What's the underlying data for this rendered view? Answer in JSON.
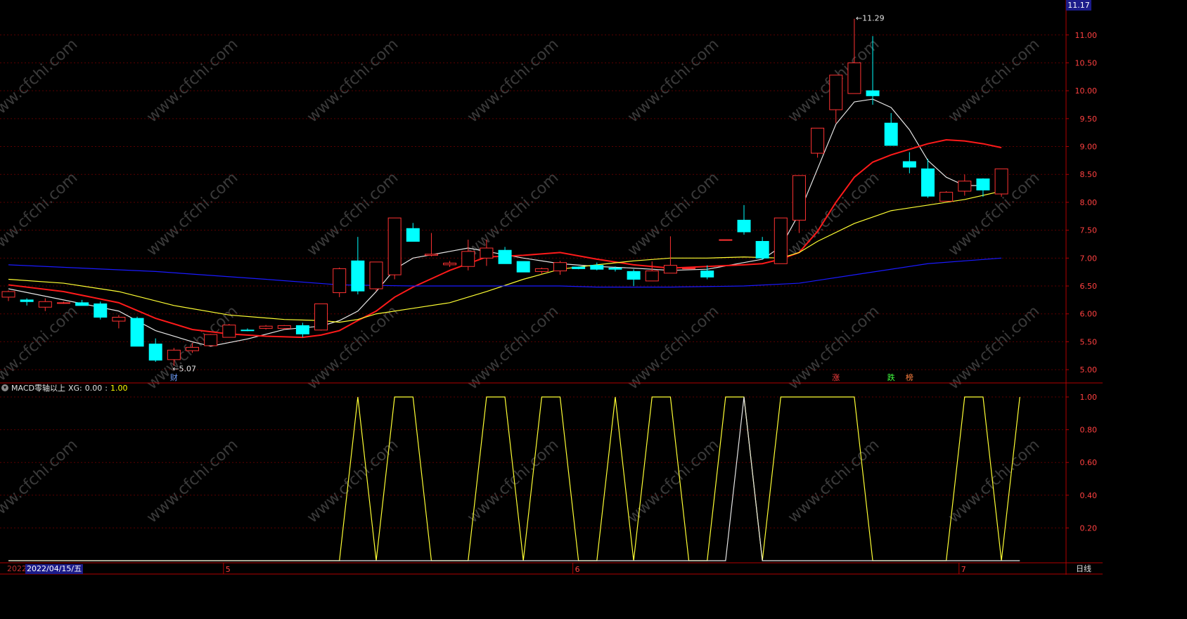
{
  "chart_data": [
    {
      "type": "candlestick",
      "title": "",
      "y_ticks": [
        "11.00",
        "10.50",
        "10.00",
        "9.50",
        "9.00",
        "8.50",
        "8.00",
        "7.50",
        "7.00",
        "6.50",
        "6.00",
        "5.50",
        "5.00"
      ],
      "ylim": [
        4.8,
        11.4
      ],
      "current_price": "11.17",
      "annotations": {
        "high_label": "11.29",
        "low_label": "5.07",
        "event_markers": [
          "财",
          "涨",
          "跌",
          "榜"
        ]
      },
      "candles": [
        {
          "o": 6.3,
          "h": 6.42,
          "l": 6.23,
          "c": 6.4
        },
        {
          "o": 6.25,
          "h": 6.28,
          "l": 6.15,
          "c": 6.22
        },
        {
          "o": 6.12,
          "h": 6.28,
          "l": 6.05,
          "c": 6.22
        },
        {
          "o": 6.19,
          "h": 6.22,
          "l": 6.18,
          "c": 6.2
        },
        {
          "o": 6.2,
          "h": 6.25,
          "l": 6.15,
          "c": 6.15
        },
        {
          "o": 6.18,
          "h": 6.22,
          "l": 5.9,
          "c": 5.94
        },
        {
          "o": 5.87,
          "h": 5.98,
          "l": 5.74,
          "c": 5.94
        },
        {
          "o": 5.92,
          "h": 5.95,
          "l": 5.44,
          "c": 5.42
        },
        {
          "o": 5.46,
          "h": 5.56,
          "l": 5.14,
          "c": 5.17
        },
        {
          "o": 5.18,
          "h": 5.39,
          "l": 5.07,
          "c": 5.35
        },
        {
          "o": 5.34,
          "h": 5.48,
          "l": 5.3,
          "c": 5.4
        },
        {
          "o": 5.43,
          "h": 5.64,
          "l": 5.43,
          "c": 5.63
        },
        {
          "o": 5.58,
          "h": 5.82,
          "l": 5.58,
          "c": 5.8
        },
        {
          "o": 5.71,
          "h": 5.74,
          "l": 5.69,
          "c": 5.7
        },
        {
          "o": 5.74,
          "h": 5.8,
          "l": 5.72,
          "c": 5.78
        },
        {
          "o": 5.74,
          "h": 5.8,
          "l": 5.72,
          "c": 5.79
        },
        {
          "o": 5.79,
          "h": 5.84,
          "l": 5.58,
          "c": 5.64
        },
        {
          "o": 5.71,
          "h": 6.18,
          "l": 5.7,
          "c": 6.18
        },
        {
          "o": 6.38,
          "h": 6.83,
          "l": 6.3,
          "c": 6.81
        },
        {
          "o": 6.95,
          "h": 7.38,
          "l": 6.35,
          "c": 6.41
        },
        {
          "o": 6.45,
          "h": 6.93,
          "l": 6.41,
          "c": 6.93
        },
        {
          "o": 6.7,
          "h": 7.72,
          "l": 6.62,
          "c": 7.72
        },
        {
          "o": 7.53,
          "h": 7.63,
          "l": 7.3,
          "c": 7.3
        },
        {
          "o": 7.05,
          "h": 7.45,
          "l": 7.03,
          "c": 7.07
        },
        {
          "o": 6.88,
          "h": 6.95,
          "l": 6.84,
          "c": 6.91
        },
        {
          "o": 6.85,
          "h": 7.33,
          "l": 6.78,
          "c": 7.12
        },
        {
          "o": 7.0,
          "h": 7.33,
          "l": 6.86,
          "c": 7.18
        },
        {
          "o": 7.14,
          "h": 7.2,
          "l": 6.9,
          "c": 6.9
        },
        {
          "o": 6.94,
          "h": 6.94,
          "l": 6.75,
          "c": 6.75
        },
        {
          "o": 6.76,
          "h": 6.83,
          "l": 6.71,
          "c": 6.81
        },
        {
          "o": 6.77,
          "h": 6.95,
          "l": 6.7,
          "c": 6.92
        },
        {
          "o": 6.84,
          "h": 6.85,
          "l": 6.8,
          "c": 6.81
        },
        {
          "o": 6.87,
          "h": 6.92,
          "l": 6.78,
          "c": 6.8
        },
        {
          "o": 6.82,
          "h": 6.85,
          "l": 6.76,
          "c": 6.8
        },
        {
          "o": 6.76,
          "h": 6.8,
          "l": 6.5,
          "c": 6.62
        },
        {
          "o": 6.59,
          "h": 6.94,
          "l": 6.59,
          "c": 6.77
        },
        {
          "o": 6.73,
          "h": 7.39,
          "l": 6.73,
          "c": 6.87
        },
        {
          "o": 6.82,
          "h": 6.82,
          "l": 6.82,
          "c": 6.82
        },
        {
          "o": 6.77,
          "h": 6.87,
          "l": 6.62,
          "c": 6.66
        },
        {
          "o": 7.33,
          "h": 7.33,
          "l": 7.33,
          "c": 7.33
        },
        {
          "o": 7.68,
          "h": 7.95,
          "l": 7.42,
          "c": 7.47
        },
        {
          "o": 7.3,
          "h": 7.38,
          "l": 6.97,
          "c": 7.0
        },
        {
          "o": 6.9,
          "h": 7.72,
          "l": 6.9,
          "c": 7.72
        },
        {
          "o": 7.68,
          "h": 8.48,
          "l": 7.45,
          "c": 8.48
        },
        {
          "o": 8.88,
          "h": 9.33,
          "l": 8.8,
          "c": 9.33
        },
        {
          "o": 9.66,
          "h": 10.28,
          "l": 9.42,
          "c": 10.28
        },
        {
          "o": 9.95,
          "h": 11.29,
          "l": 9.95,
          "c": 10.5
        },
        {
          "o": 10.0,
          "h": 10.98,
          "l": 9.75,
          "c": 9.91
        },
        {
          "o": 9.42,
          "h": 9.6,
          "l": 9.02,
          "c": 9.02
        },
        {
          "o": 8.73,
          "h": 8.9,
          "l": 8.52,
          "c": 8.63
        },
        {
          "o": 8.6,
          "h": 8.78,
          "l": 8.08,
          "c": 8.11
        },
        {
          "o": 8.02,
          "h": 8.2,
          "l": 8.02,
          "c": 8.18
        },
        {
          "o": 8.2,
          "h": 8.5,
          "l": 8.12,
          "c": 8.38
        },
        {
          "o": 8.42,
          "h": 8.43,
          "l": 8.1,
          "c": 8.22
        },
        {
          "o": 8.15,
          "h": 8.6,
          "l": 8.1,
          "c": 8.6
        }
      ],
      "moving_averages": [
        {
          "color": "#e6e6e6",
          "points": [
            [
              0,
              6.45
            ],
            [
              3,
              6.25
            ],
            [
              6,
              6.05
            ],
            [
              8,
              5.7
            ],
            [
              10,
              5.5
            ],
            [
              11,
              5.42
            ],
            [
              13,
              5.55
            ],
            [
              15,
              5.72
            ],
            [
              17,
              5.78
            ],
            [
              18,
              5.88
            ],
            [
              19,
              6.05
            ],
            [
              20,
              6.4
            ],
            [
              21,
              6.8
            ],
            [
              22,
              7.0
            ],
            [
              24,
              7.12
            ],
            [
              25,
              7.18
            ],
            [
              26,
              7.12
            ],
            [
              28,
              7.0
            ],
            [
              30,
              6.9
            ],
            [
              32,
              6.85
            ],
            [
              34,
              6.82
            ],
            [
              36,
              6.78
            ],
            [
              38,
              6.8
            ],
            [
              40,
              6.92
            ],
            [
              41,
              6.98
            ],
            [
              42,
              7.2
            ],
            [
              43,
              7.8
            ],
            [
              44,
              8.6
            ],
            [
              45,
              9.4
            ],
            [
              46,
              9.8
            ],
            [
              47,
              9.85
            ],
            [
              48,
              9.7
            ],
            [
              49,
              9.3
            ],
            [
              50,
              8.75
            ],
            [
              51,
              8.45
            ],
            [
              52,
              8.3
            ],
            [
              53,
              8.3
            ]
          ]
        },
        {
          "color": "#ff1a1a",
          "points": [
            [
              0,
              6.52
            ],
            [
              3,
              6.4
            ],
            [
              6,
              6.2
            ],
            [
              8,
              5.92
            ],
            [
              10,
              5.72
            ],
            [
              12,
              5.64
            ],
            [
              14,
              5.6
            ],
            [
              16,
              5.58
            ],
            [
              17,
              5.62
            ],
            [
              18,
              5.7
            ],
            [
              19,
              5.88
            ],
            [
              20,
              6.05
            ],
            [
              21,
              6.3
            ],
            [
              22,
              6.48
            ],
            [
              24,
              6.78
            ],
            [
              26,
              7.02
            ],
            [
              28,
              7.05
            ],
            [
              30,
              7.1
            ],
            [
              32,
              6.98
            ],
            [
              34,
              6.88
            ],
            [
              36,
              6.82
            ],
            [
              38,
              6.85
            ],
            [
              40,
              6.88
            ],
            [
              41,
              6.9
            ],
            [
              42,
              6.98
            ],
            [
              43,
              7.1
            ],
            [
              44,
              7.48
            ],
            [
              45,
              8.0
            ],
            [
              46,
              8.45
            ],
            [
              47,
              8.72
            ],
            [
              48,
              8.85
            ],
            [
              49,
              8.95
            ],
            [
              50,
              9.05
            ],
            [
              51,
              9.12
            ],
            [
              52,
              9.1
            ],
            [
              53,
              9.05
            ],
            [
              54,
              8.98
            ]
          ]
        },
        {
          "color": "#ffff33",
          "points": [
            [
              0,
              6.62
            ],
            [
              3,
              6.55
            ],
            [
              6,
              6.4
            ],
            [
              9,
              6.15
            ],
            [
              12,
              5.98
            ],
            [
              15,
              5.9
            ],
            [
              17,
              5.88
            ],
            [
              18,
              5.85
            ],
            [
              19,
              5.9
            ],
            [
              20,
              6.0
            ],
            [
              22,
              6.1
            ],
            [
              24,
              6.2
            ],
            [
              26,
              6.4
            ],
            [
              28,
              6.62
            ],
            [
              30,
              6.8
            ],
            [
              32,
              6.88
            ],
            [
              34,
              6.95
            ],
            [
              36,
              7.0
            ],
            [
              38,
              7.0
            ],
            [
              40,
              7.02
            ],
            [
              42,
              7.0
            ],
            [
              43,
              7.1
            ],
            [
              44,
              7.3
            ],
            [
              46,
              7.62
            ],
            [
              48,
              7.85
            ],
            [
              50,
              7.95
            ],
            [
              52,
              8.05
            ],
            [
              54,
              8.2
            ]
          ]
        },
        {
          "color": "#1a1aff",
          "points": [
            [
              0,
              6.88
            ],
            [
              8,
              6.76
            ],
            [
              14,
              6.62
            ],
            [
              18,
              6.52
            ],
            [
              22,
              6.5
            ],
            [
              26,
              6.5
            ],
            [
              30,
              6.5
            ],
            [
              32,
              6.48
            ],
            [
              36,
              6.48
            ],
            [
              40,
              6.5
            ],
            [
              43,
              6.55
            ],
            [
              46,
              6.7
            ],
            [
              50,
              6.9
            ],
            [
              54,
              7.0
            ]
          ]
        }
      ]
    },
    {
      "type": "line",
      "title": "",
      "indicator_name": "MACD零轴以上",
      "xg_label": "XG:",
      "xg_value": "0.00",
      "second_value": "1.00",
      "y_ticks": [
        "1.00",
        "0.80",
        "0.60",
        "0.40",
        "0.20"
      ],
      "ylim": [
        0,
        1
      ],
      "series": [
        {
          "color": "#ffff33",
          "values": [
            0,
            0,
            0,
            0,
            0,
            0,
            0,
            0,
            0,
            0,
            0,
            0,
            0,
            0,
            0,
            0,
            0,
            0,
            0,
            1,
            0,
            1,
            1,
            0,
            0,
            0,
            1,
            1,
            0,
            1,
            1,
            0,
            0,
            1,
            0,
            1,
            1,
            0,
            0,
            1,
            1,
            0,
            1,
            1,
            1,
            1,
            1,
            0,
            0,
            0,
            0,
            0,
            1,
            1,
            0,
            1
          ]
        },
        {
          "color": "#e6e6e6",
          "values": [
            0,
            0,
            0,
            0,
            0,
            0,
            0,
            0,
            0,
            0,
            0,
            0,
            0,
            0,
            0,
            0,
            0,
            0,
            0,
            0,
            0,
            0,
            0,
            0,
            0,
            0,
            0,
            0,
            0,
            0,
            0,
            0,
            0,
            0,
            0,
            0,
            0,
            0,
            0,
            0,
            1,
            0,
            0,
            0,
            0,
            0,
            0,
            0,
            0,
            0,
            0,
            0,
            0,
            0,
            0,
            0
          ]
        }
      ],
      "x_ticks": [
        "5",
        "6",
        "7"
      ]
    }
  ],
  "status_bar": {
    "year_stub": "2022",
    "date_label": "2022/04/15/五",
    "period_label": "日线"
  },
  "watermark": "www.cfchi.com",
  "colors": {
    "up": "#ff3232",
    "down": "#00ffff",
    "axis": "#b00000",
    "grid": "#5a0000",
    "tick_text": "#ff4040"
  }
}
